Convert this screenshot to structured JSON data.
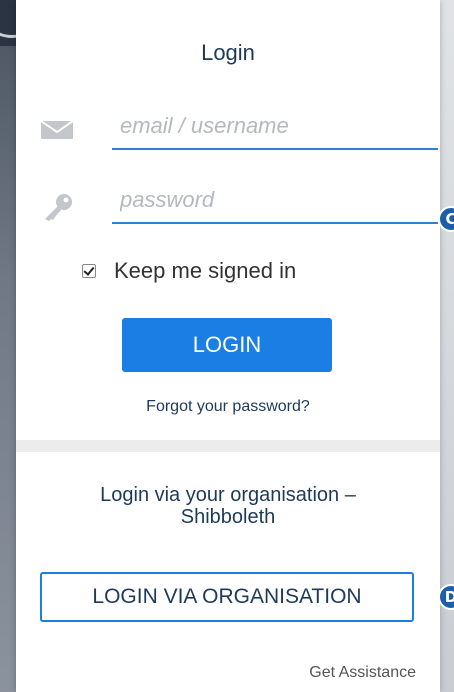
{
  "form": {
    "title": "Login",
    "email_placeholder": "email / username",
    "password_placeholder": "password",
    "keep_signed_in_label": "Keep me signed in",
    "keep_signed_in_checked": true,
    "login_label": "LOGIN",
    "forgot_label": "Forgot your password?"
  },
  "organisation": {
    "heading_line1": "Login via your organisation –",
    "heading_line2": "Shibboleth",
    "button_label": "LOGIN VIA ORGANISATION"
  },
  "footer": {
    "assistance_label": "Get Assistance"
  },
  "annotations": {
    "badge_c": "C",
    "badge_d": "D"
  },
  "icons": {
    "email": "envelope-icon",
    "password": "key-icon"
  },
  "colors": {
    "accent": "#1a7ee4",
    "heading": "#1e3a5a",
    "underline": "#2a82d8"
  }
}
